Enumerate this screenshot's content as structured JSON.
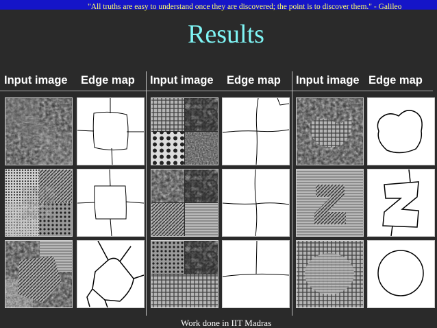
{
  "quote": "\"All truths are easy to understand once they are discovered; the point is to discover them.\" - Galileo",
  "title": "Results",
  "headers": [
    "Input image",
    "Edge map",
    "Input image",
    "Edge map",
    "Input image",
    "Edge map"
  ],
  "footer": "Work done in IIT Madras"
}
